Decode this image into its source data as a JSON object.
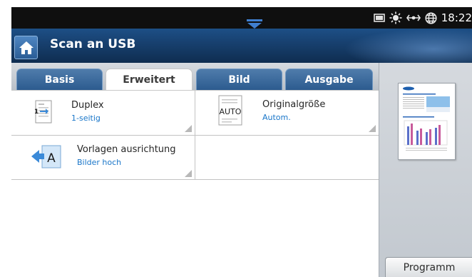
{
  "status": {
    "time": "18:22"
  },
  "title": "Scan an USB",
  "tabs": [
    {
      "label": "Basis"
    },
    {
      "label": "Erweitert"
    },
    {
      "label": "Bild"
    },
    {
      "label": "Ausgabe"
    }
  ],
  "options": [
    {
      "label": "Duplex",
      "value": "1-seitig",
      "icon": "duplex-icon"
    },
    {
      "label": "Originalgröße",
      "value": "Autom.",
      "icon_text": "AUTO",
      "icon": "original-size-icon"
    },
    {
      "label": "Vorlagen ausrichtung",
      "value": "Bilder hoch",
      "icon_text": "A",
      "icon": "orientation-icon"
    }
  ],
  "preview": {
    "button_label": "Programm"
  },
  "colors": {
    "accent_blue": "#1976c9",
    "titlebar": "#173f6d",
    "tab_inactive": "#2c5b8f"
  }
}
